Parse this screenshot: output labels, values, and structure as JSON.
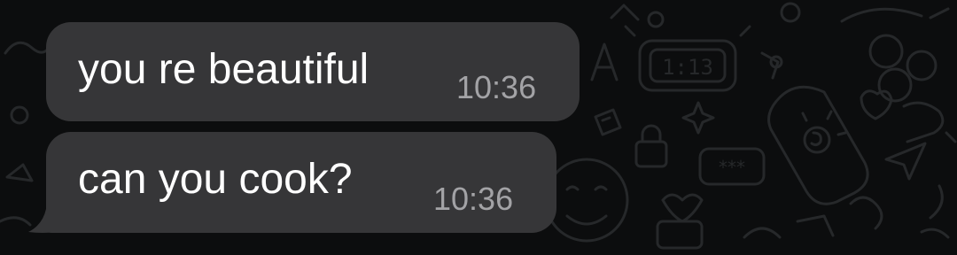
{
  "chat": {
    "wallpaper": "doodle-pattern",
    "wallpaper_doodles": [
      "clock-icon",
      "lock-icon",
      "smiley-icon",
      "star-icon",
      "password-icon",
      "bottle-icon",
      "heart-icon",
      "sun-icon",
      "plane-icon"
    ],
    "messages": [
      {
        "text": "you re beautiful",
        "time": "10:36",
        "direction": "incoming"
      },
      {
        "text": "can you cook?",
        "time": "10:36",
        "direction": "incoming"
      }
    ]
  },
  "colors": {
    "background": "#0c0d0e",
    "bubble": "#363638",
    "text": "#ffffff",
    "timestamp": "#a3a3a6",
    "doodle": "#26282a"
  }
}
